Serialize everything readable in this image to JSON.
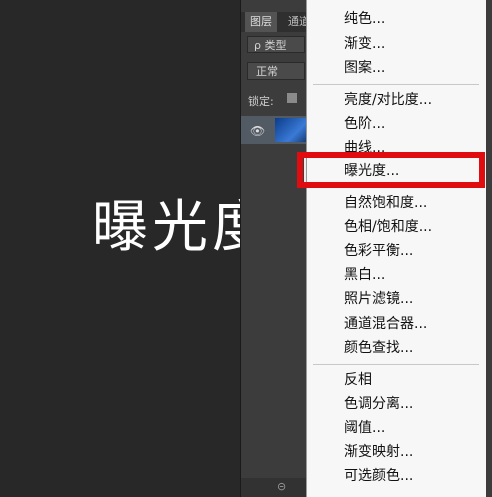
{
  "caption": "曝光度",
  "layers_panel": {
    "tabs": [
      "图层",
      "通道"
    ],
    "kind_filter": "ρ 类型",
    "blend_mode": "正常",
    "lock_label": "锁定:",
    "eye_glyph": "👁"
  },
  "menu": {
    "group1": [
      "纯色...",
      "渐变...",
      "图案..."
    ],
    "group2": [
      "亮度/对比度...",
      "色阶...",
      "曲线...",
      "曝光度...",
      "自然饱和度...",
      "色相/饱和度...",
      "色彩平衡...",
      "黑白...",
      "照片滤镜...",
      "通道混合器...",
      "颜色查找..."
    ],
    "group3": [
      "反相",
      "色调分离...",
      "阈值...",
      "渐变映射...",
      "可选颜色..."
    ],
    "highlighted": "曝光度..."
  },
  "colors": {
    "highlight_border": "#e00d10",
    "menu_bg": "#f7f7f7",
    "canvas_bg": "#282828"
  }
}
